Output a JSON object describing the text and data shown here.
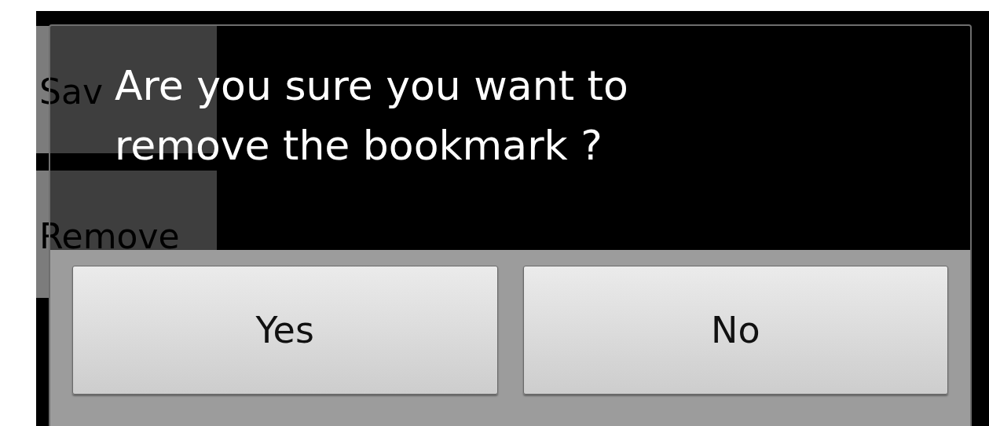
{
  "background_menu": {
    "items": [
      {
        "label": "Sav"
      },
      {
        "label": "Remove"
      }
    ]
  },
  "dialog": {
    "message": "Are you sure you want to remove the bookmark ?",
    "buttons": [
      {
        "label": "Yes"
      },
      {
        "label": "No"
      }
    ]
  }
}
